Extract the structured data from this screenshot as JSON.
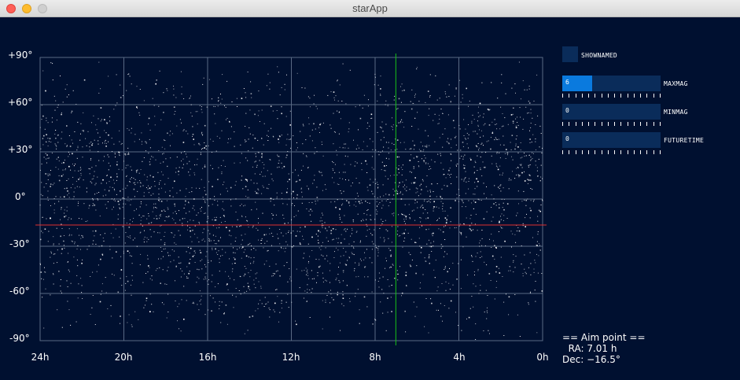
{
  "window": {
    "title": "starApp"
  },
  "chart_data": {
    "type": "scatter",
    "title": "",
    "xlabel": "",
    "ylabel": "",
    "x_axis": {
      "label_unit": "hours right ascension",
      "ticks": [
        "24h",
        "20h",
        "16h",
        "12h",
        "8h",
        "4h",
        "0h"
      ],
      "range": [
        24,
        0
      ]
    },
    "y_axis": {
      "label_unit": "degrees declination",
      "ticks": [
        "+90°",
        "+60°",
        "+30°",
        "0°",
        "-30°",
        "-60°",
        "-90°"
      ],
      "range": [
        -90,
        90
      ]
    },
    "grid": true,
    "aim_ra_hours": 7.01,
    "aim_dec_degrees": -16.5,
    "star_count_approx": 4000,
    "colors": {
      "background": "#001030",
      "stars": "#ffffff",
      "grid": "#5a6a85",
      "ra_line": "#18c018",
      "dec_line": "#e03030"
    }
  },
  "controls": {
    "shownamed": {
      "label": "SHOWNAMED"
    },
    "maxmag": {
      "label": "MAXMAG",
      "value": "6",
      "fraction": 0.3
    },
    "minmag": {
      "label": "MINMAG",
      "value": "0",
      "fraction": 0.0
    },
    "futuretime": {
      "label": "FUTURETIME",
      "value": "0",
      "fraction": 0.0
    }
  },
  "aim_point": {
    "header": "== Aim point ==",
    "ra": "  RA: 7.01 h",
    "dec": "Dec: −16.5°"
  }
}
